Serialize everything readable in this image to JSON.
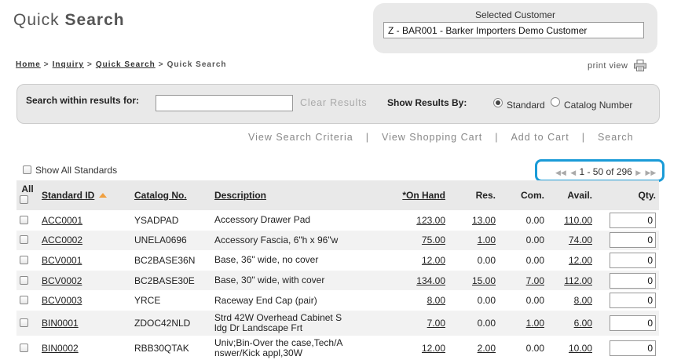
{
  "page": {
    "title_light": "Quick",
    "title_bold": "Search"
  },
  "customer": {
    "label": "Selected Customer",
    "value": "Z - BAR001 - Barker Importers Demo Customer"
  },
  "breadcrumb": {
    "items": [
      "Home",
      "Inquiry",
      "Quick Search"
    ],
    "current": "Quick Search",
    "separator": ">"
  },
  "print_view": {
    "label": "print view",
    "icon": "printer-icon"
  },
  "search_panel": {
    "label": "Search within results for:",
    "input_value": "",
    "clear_label": "Clear Results",
    "show_by_label": "Show Results By:",
    "options": [
      "Standard",
      "Catalog Number"
    ],
    "selected": "Standard"
  },
  "actions": [
    "View Search Criteria",
    "View Shopping Cart",
    "Add to Cart",
    "Search"
  ],
  "show_all": {
    "label": "Show All Standards",
    "checked": false
  },
  "pager": {
    "text": "1 - 50 of 296",
    "highlight_color": "#1a9bd7"
  },
  "table": {
    "headers": {
      "all": "All",
      "standard_id": "Standard ID",
      "catalog_no": "Catalog No.",
      "description": "Description",
      "on_hand": "*On Hand",
      "res": "Res.",
      "com": "Com.",
      "avail": "Avail.",
      "qty": "Qty."
    },
    "rows": [
      {
        "id": "ACC0001",
        "catalog": "YSADPAD",
        "desc1": "Accessory Drawer Pad",
        "desc2": "",
        "on_hand": "123.00",
        "res": "13.00",
        "com": "0.00",
        "avail": "110.00",
        "qty": "0"
      },
      {
        "id": "ACC0002",
        "catalog": "UNELA0696",
        "desc1": "Accessory Fascia, 6\"h x 96\"w",
        "desc2": "",
        "on_hand": "75.00",
        "res": "1.00",
        "com": "0.00",
        "avail": "74.00",
        "qty": "0"
      },
      {
        "id": "BCV0001",
        "catalog": "BC2BASE36N",
        "desc1": "Base, 36\" wide, no cover",
        "desc2": "",
        "on_hand": "12.00",
        "res": "0.00",
        "com": "0.00",
        "avail": "12.00",
        "qty": "0"
      },
      {
        "id": "BCV0002",
        "catalog": "BC2BASE30E",
        "desc1": "Base, 30\" wide, with cover",
        "desc2": "",
        "on_hand": "134.00",
        "res": "15.00",
        "com": "7.00",
        "avail": "112.00",
        "qty": "0"
      },
      {
        "id": "BCV0003",
        "catalog": "YRCE",
        "desc1": "Raceway End Cap (pair)",
        "desc2": "",
        "on_hand": "8.00",
        "res": "0.00",
        "com": "0.00",
        "avail": "8.00",
        "qty": "0"
      },
      {
        "id": "BIN0001",
        "catalog": "ZDOC42NLD",
        "desc1": "Strd 42W Overhead Cabinet S",
        "desc2": "ldg Dr Landscape Frt",
        "on_hand": "7.00",
        "res": "0.00",
        "com": "1.00",
        "avail": "6.00",
        "qty": "0"
      },
      {
        "id": "BIN0002",
        "catalog": "RBB30QTAK",
        "desc1": "Univ;Bin-Over the case,Tech/A",
        "desc2": "nswer/Kick appl,30W",
        "on_hand": "12.00",
        "res": "2.00",
        "com": "0.00",
        "avail": "10.00",
        "qty": "0"
      }
    ]
  }
}
